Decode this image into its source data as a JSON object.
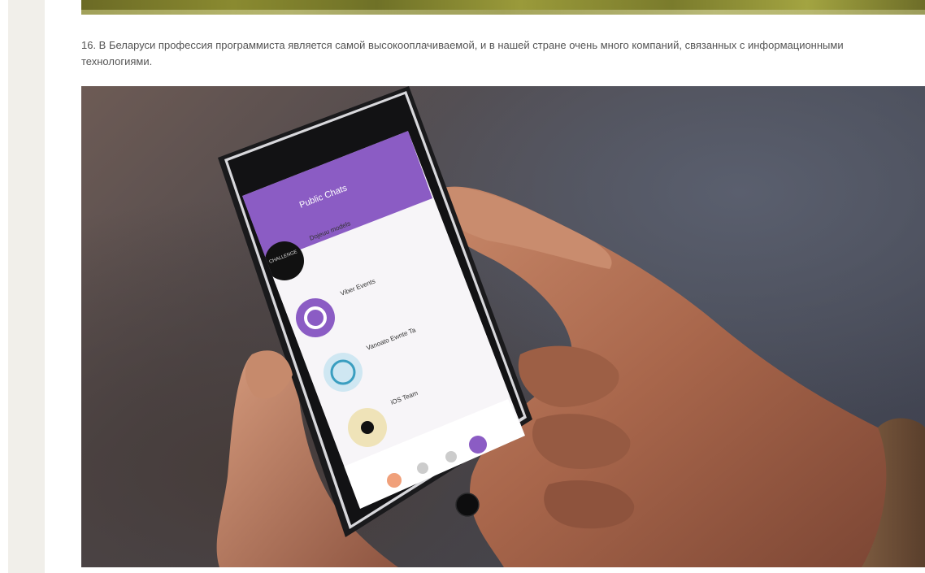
{
  "article": {
    "paragraph": "16. В Беларуси профессия программиста является самой высокооплачиваемой, и в нашей стране очень много компаний, связанных с информационными технологиями."
  },
  "phone_screen": {
    "header_title": "Public Chats",
    "chats": [
      {
        "name": "Dojeuu models",
        "logo_text": "CHALLENGE"
      },
      {
        "name": "Viber Events"
      },
      {
        "name": "Vanoato Ewnte Ta"
      },
      {
        "name": "iOS Team"
      }
    ]
  },
  "colors": {
    "viber_purple": "#8b5cc4",
    "page_text": "#555555",
    "gutter": "#f1efea"
  }
}
